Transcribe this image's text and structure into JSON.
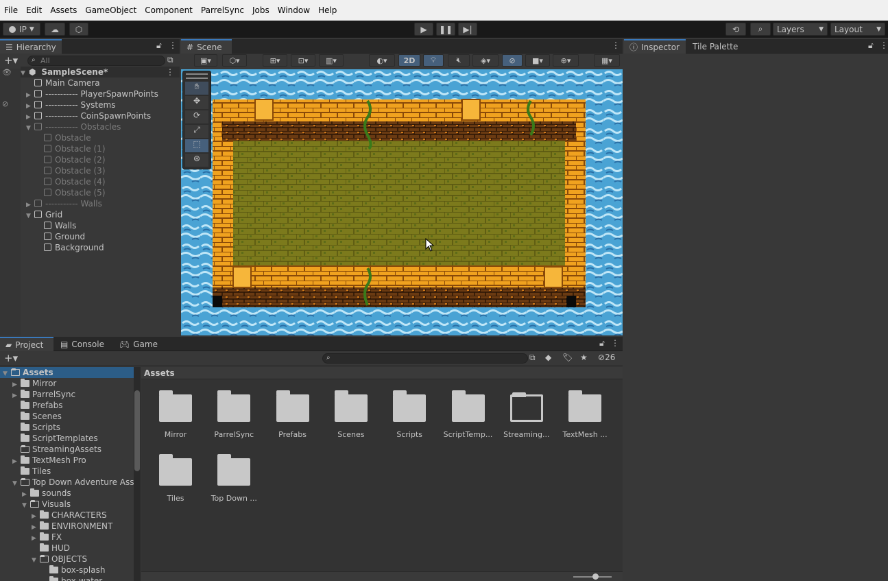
{
  "menu": [
    "File",
    "Edit",
    "Assets",
    "GameObject",
    "Component",
    "ParrelSync",
    "Jobs",
    "Window",
    "Help"
  ],
  "toolbar": {
    "account_label": "IP",
    "layers_label": "Layers",
    "layout_label": "Layout"
  },
  "hierarchy": {
    "tab_label": "Hierarchy",
    "search_placeholder": "All",
    "scene_name": "SampleScene*",
    "items": [
      {
        "label": "Main Camera",
        "depth": 1,
        "arrow": "",
        "dim": false
      },
      {
        "label": "----------- PlayerSpawnPoints",
        "depth": 1,
        "arrow": "right",
        "dim": false
      },
      {
        "label": "----------- Systems",
        "depth": 1,
        "arrow": "right",
        "dim": false
      },
      {
        "label": "----------- CoinSpawnPoints",
        "depth": 1,
        "arrow": "right",
        "dim": false
      },
      {
        "label": "----------- Obstacles",
        "depth": 1,
        "arrow": "down",
        "dim": true
      },
      {
        "label": "Obstacle",
        "depth": 2,
        "arrow": "",
        "dim": true
      },
      {
        "label": "Obstacle (1)",
        "depth": 2,
        "arrow": "",
        "dim": true
      },
      {
        "label": "Obstacle (2)",
        "depth": 2,
        "arrow": "",
        "dim": true
      },
      {
        "label": "Obstacle (3)",
        "depth": 2,
        "arrow": "",
        "dim": true
      },
      {
        "label": "Obstacle (4)",
        "depth": 2,
        "arrow": "",
        "dim": true
      },
      {
        "label": "Obstacle (5)",
        "depth": 2,
        "arrow": "",
        "dim": true
      },
      {
        "label": "----------- Walls",
        "depth": 1,
        "arrow": "right",
        "dim": true
      },
      {
        "label": "Grid",
        "depth": 1,
        "arrow": "down",
        "dim": false
      },
      {
        "label": "Walls",
        "depth": 2,
        "arrow": "",
        "dim": false
      },
      {
        "label": "Ground",
        "depth": 2,
        "arrow": "",
        "dim": false
      },
      {
        "label": "Background",
        "depth": 2,
        "arrow": "",
        "dim": false
      }
    ]
  },
  "scene": {
    "tab_label": "Scene",
    "mode_2d": "2D"
  },
  "inspector": {
    "tab_inspector": "Inspector",
    "tab_tile_palette": "Tile Palette"
  },
  "bottom_tabs": {
    "project": "Project",
    "console": "Console",
    "game": "Game",
    "hidden_count": "26"
  },
  "project_tree": [
    {
      "label": "Assets",
      "depth": 0,
      "arrow": "down",
      "bold": true,
      "open": true
    },
    {
      "label": "Mirror",
      "depth": 1,
      "arrow": "right"
    },
    {
      "label": "ParrelSync",
      "depth": 1,
      "arrow": "right"
    },
    {
      "label": "Prefabs",
      "depth": 1,
      "arrow": ""
    },
    {
      "label": "Scenes",
      "depth": 1,
      "arrow": ""
    },
    {
      "label": "Scripts",
      "depth": 1,
      "arrow": ""
    },
    {
      "label": "ScriptTemplates",
      "depth": 1,
      "arrow": ""
    },
    {
      "label": "StreamingAssets",
      "depth": 1,
      "arrow": "",
      "open": true
    },
    {
      "label": "TextMesh Pro",
      "depth": 1,
      "arrow": "right"
    },
    {
      "label": "Tiles",
      "depth": 1,
      "arrow": ""
    },
    {
      "label": "Top Down Adventure Asse",
      "depth": 1,
      "arrow": "down",
      "open": true
    },
    {
      "label": "sounds",
      "depth": 2,
      "arrow": "right"
    },
    {
      "label": "Visuals",
      "depth": 2,
      "arrow": "down",
      "open": true
    },
    {
      "label": "CHARACTERS",
      "depth": 3,
      "arrow": "right"
    },
    {
      "label": "ENVIRONMENT",
      "depth": 3,
      "arrow": "right"
    },
    {
      "label": "FX",
      "depth": 3,
      "arrow": "right"
    },
    {
      "label": "HUD",
      "depth": 3,
      "arrow": ""
    },
    {
      "label": "OBJECTS",
      "depth": 3,
      "arrow": "down",
      "open": true
    },
    {
      "label": "box-splash",
      "depth": 4,
      "arrow": ""
    },
    {
      "label": "box-water",
      "depth": 4,
      "arrow": ""
    }
  ],
  "assets_header": "Assets",
  "asset_items": [
    {
      "label": "Mirror",
      "empty": false
    },
    {
      "label": "ParrelSync",
      "empty": false
    },
    {
      "label": "Prefabs",
      "empty": false
    },
    {
      "label": "Scenes",
      "empty": false
    },
    {
      "label": "Scripts",
      "empty": false
    },
    {
      "label": "ScriptTemp...",
      "empty": false
    },
    {
      "label": "Streaming...",
      "empty": true
    },
    {
      "label": "TextMesh ...",
      "empty": false
    },
    {
      "label": "Tiles",
      "empty": false
    },
    {
      "label": "Top Down ...",
      "empty": false
    }
  ]
}
